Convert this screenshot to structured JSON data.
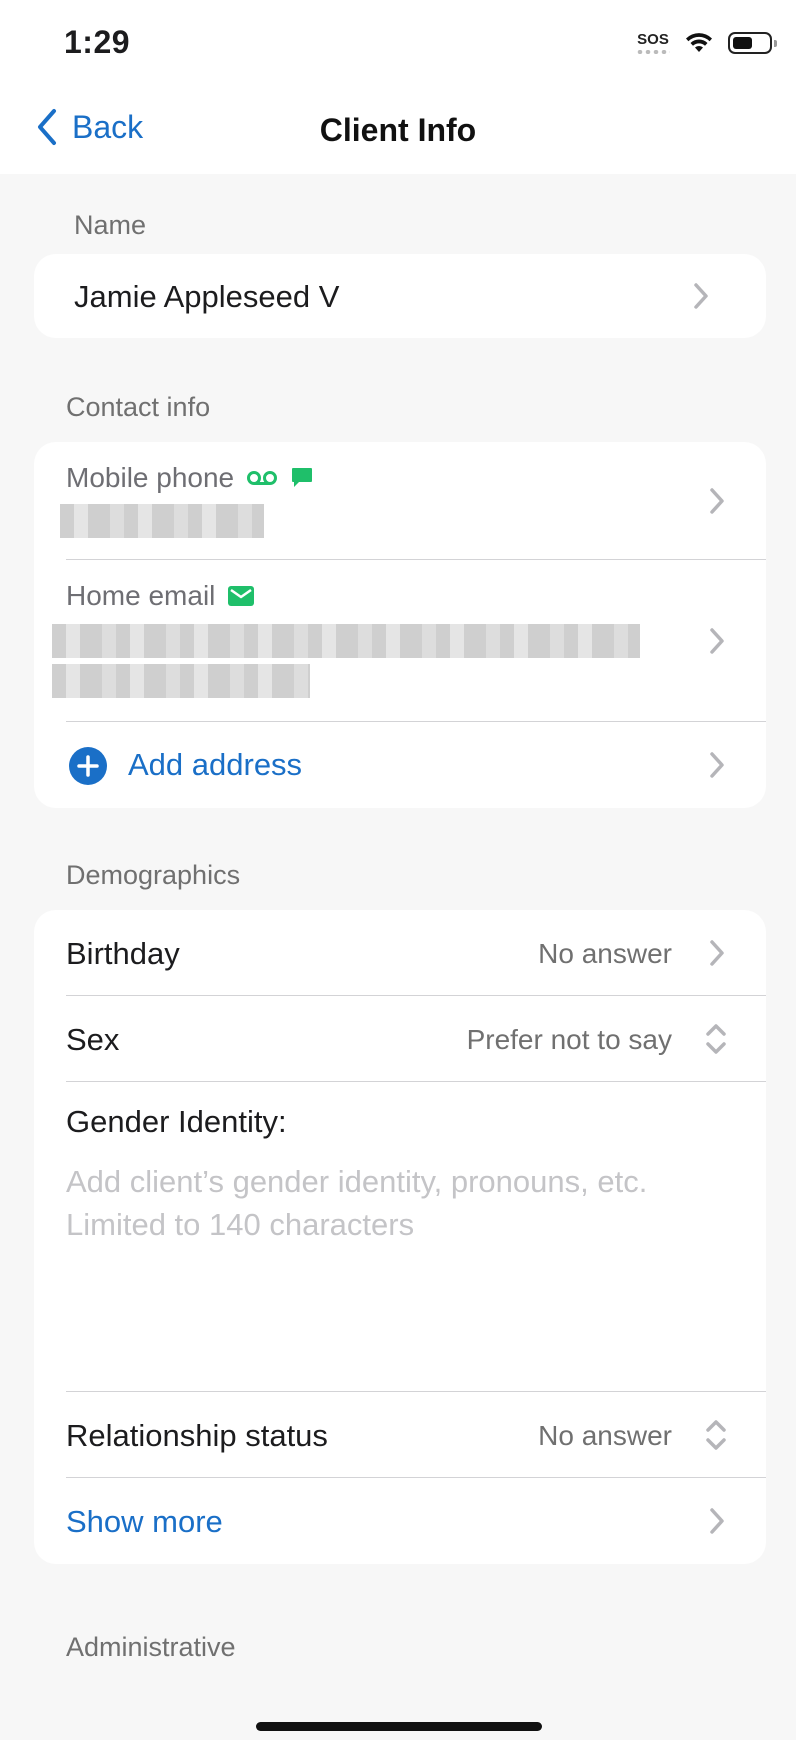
{
  "status_bar": {
    "time": "1:29",
    "sos": "SOS",
    "icons": [
      "sos-indicator",
      "wifi-icon",
      "battery-icon"
    ]
  },
  "nav": {
    "back_label": "Back",
    "title": "Client Info"
  },
  "name_section": {
    "header": "Name",
    "value": "Jamie Appleseed V"
  },
  "contact_section": {
    "header": "Contact info",
    "mobile_label": "Mobile phone",
    "home_email_label": "Home email",
    "add_address_label": "Add address"
  },
  "demographics": {
    "header": "Demographics",
    "birthday_label": "Birthday",
    "birthday_value": "No answer",
    "sex_label": "Sex",
    "sex_value": "Prefer not to say",
    "gender_label": "Gender Identity:",
    "gender_placeholder_line1": "Add client’s gender identity, pronouns, etc.",
    "gender_placeholder_line2": "Limited to 140 characters",
    "relationship_label": "Relationship status",
    "relationship_value": "No answer",
    "show_more_label": "Show more"
  },
  "administrative": {
    "header": "Administrative"
  },
  "colors": {
    "accent": "#1a6fc7",
    "green": "#1fbf6a",
    "background": "#f7f7f7"
  }
}
